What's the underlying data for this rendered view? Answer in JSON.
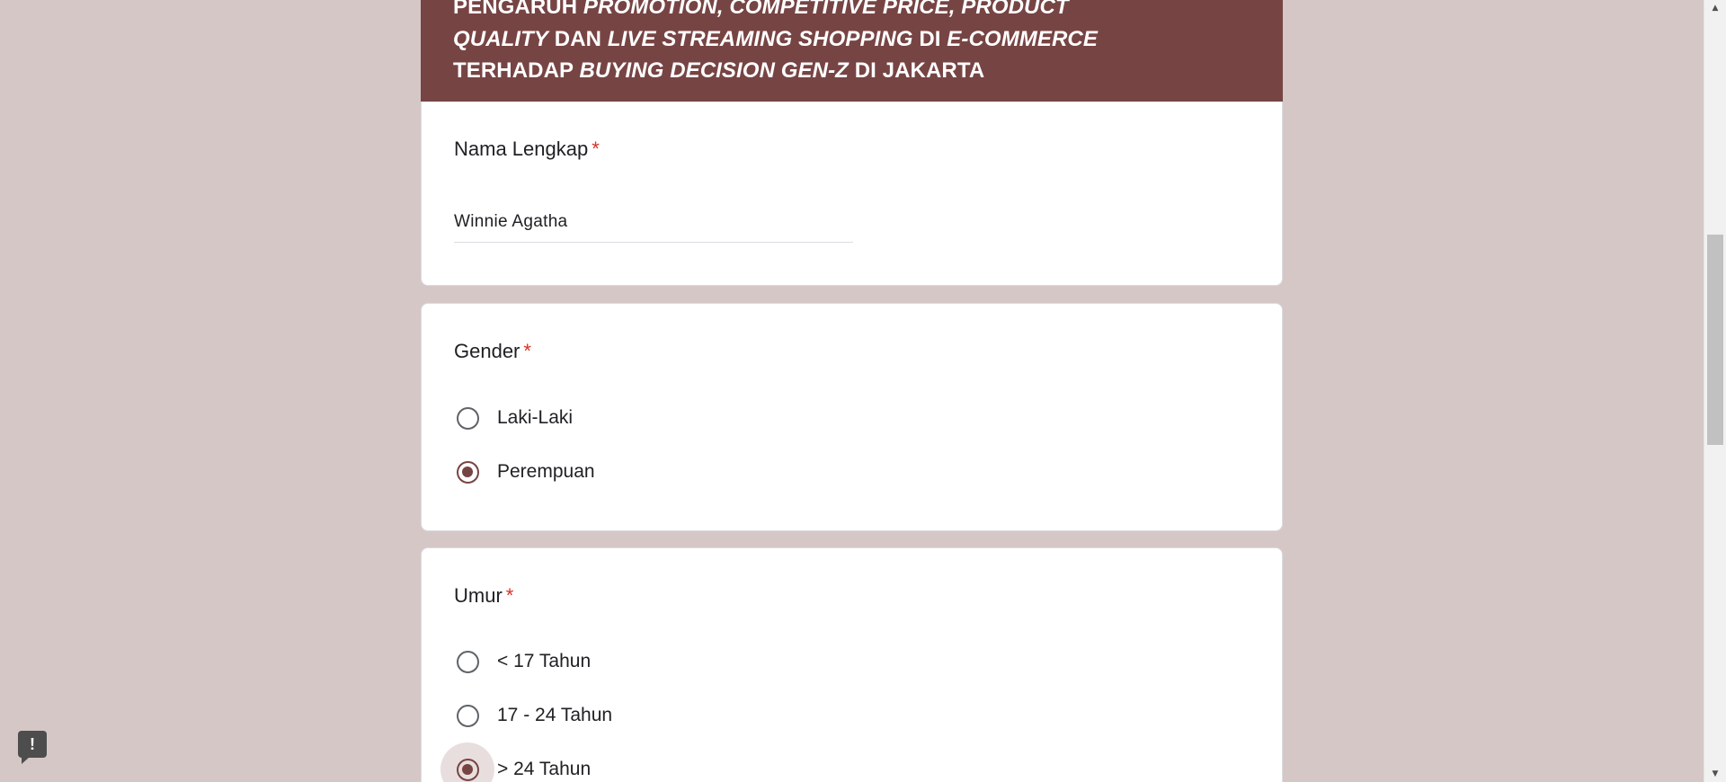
{
  "form": {
    "header": {
      "segments": [
        {
          "text": "PENGARUH ",
          "italic": false
        },
        {
          "text": "PROMOTION, COMPETITIVE PRICE, PRODUCT QUALITY",
          "italic": true
        },
        {
          "text": " DAN ",
          "italic": false
        },
        {
          "text": "LIVE STREAMING SHOPPING",
          "italic": true
        },
        {
          "text": " DI ",
          "italic": false
        },
        {
          "text": "E-COMMERCE",
          "italic": true
        },
        {
          "text": " TERHADAP ",
          "italic": false
        },
        {
          "text": "BUYING DECISION GEN-Z",
          "italic": true
        },
        {
          "text": " DI JAKARTA",
          "italic": false
        }
      ],
      "color": "#774444"
    },
    "questions": {
      "name": {
        "title": "Nama Lengkap",
        "required_mark": "*",
        "answer": "Winnie Agatha"
      },
      "gender": {
        "title": "Gender",
        "required_mark": "*",
        "options": [
          "Laki-Laki",
          "Perempuan"
        ],
        "selected": "Perempuan"
      },
      "age": {
        "title": "Umur",
        "required_mark": "*",
        "options": [
          "< 17 Tahun",
          "17 - 24 Tahun",
          "> 24 Tahun"
        ],
        "selected": "> 24 Tahun"
      }
    }
  },
  "report_button": {
    "label": "!",
    "icon": "report-issue-icon"
  },
  "colors": {
    "background": "#d6c7c7",
    "accent": "#774444",
    "required": "#d93025"
  }
}
